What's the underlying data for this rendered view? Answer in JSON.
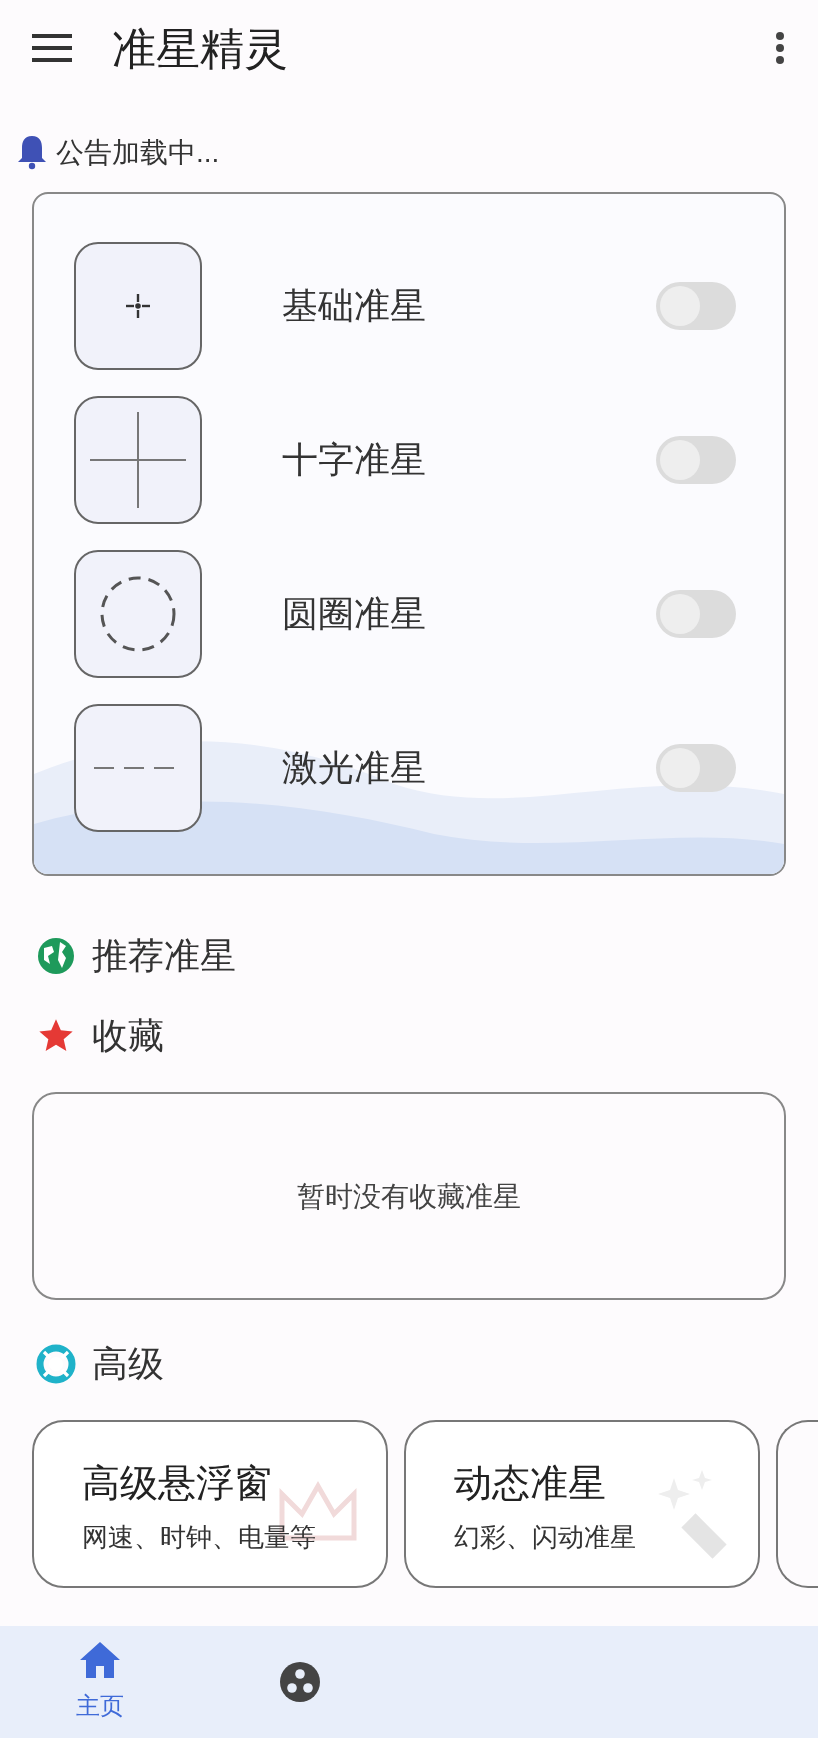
{
  "app_bar": {
    "title": "准星精灵"
  },
  "notice": {
    "text": "公告加载中..."
  },
  "crosshairs": [
    {
      "kind": "dot",
      "label": "基础准星",
      "on": false
    },
    {
      "kind": "cross",
      "label": "十字准星",
      "on": false
    },
    {
      "kind": "circle",
      "label": "圆圈准星",
      "on": false
    },
    {
      "kind": "dash",
      "label": "激光准星",
      "on": false
    }
  ],
  "sections": [
    {
      "kind": "globe",
      "title": "推荐准星"
    },
    {
      "kind": "star",
      "title": "收藏"
    }
  ],
  "favorites": {
    "empty_text": "暂时没有收藏准星"
  },
  "advanced": {
    "title": "高级",
    "cards": [
      {
        "kind": "crown",
        "title": "高级悬浮窗",
        "subtitle": "网速、时钟、电量等"
      },
      {
        "kind": "wand",
        "title": "动态准星",
        "subtitle": "幻彩、闪动准星"
      }
    ]
  },
  "bottom_nav": [
    {
      "kind": "home",
      "label": "主页",
      "selected": true
    },
    {
      "kind": "dots",
      "selected": false
    }
  ]
}
